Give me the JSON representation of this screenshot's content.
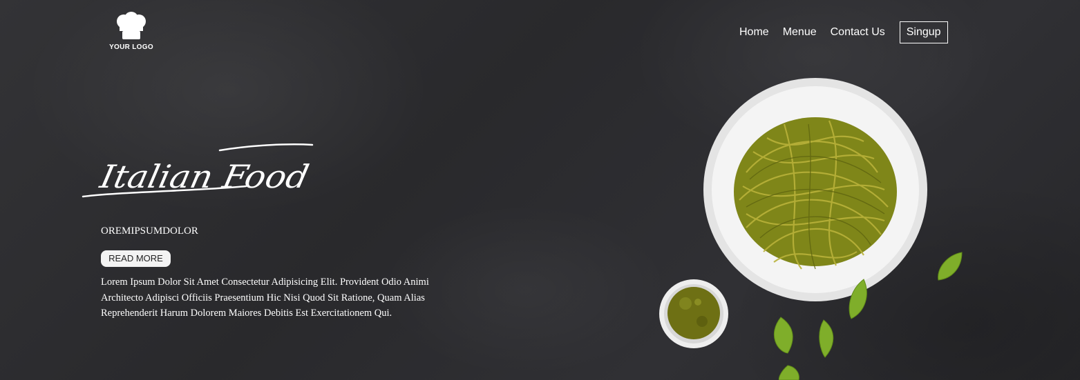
{
  "logo": {
    "text": "YOUR LOGO",
    "icon": "chef-hat-icon"
  },
  "nav": {
    "items": [
      "Home",
      "Menue",
      "Contact Us"
    ],
    "signup": "Singup"
  },
  "hero": {
    "title": "Italian Food",
    "subtitle": "OREMIPSUMDOLOR",
    "button": "READ MORE",
    "body": "Lorem Ipsum Dolor Sit Amet Consectetur Adipisicing Elit. Provident Odio Animi Architecto Adipisci Officiis Praesentium Hic Nisi Quod Sit Ratione, Quam Alias Reprehenderit Harum Dolorem Maiores Debitis Est Exercitationem Qui."
  },
  "colors": {
    "background": "#2b2b2e",
    "text": "#ffffff",
    "pesto": "#8b8f1e",
    "basil": "#7fae2a"
  }
}
